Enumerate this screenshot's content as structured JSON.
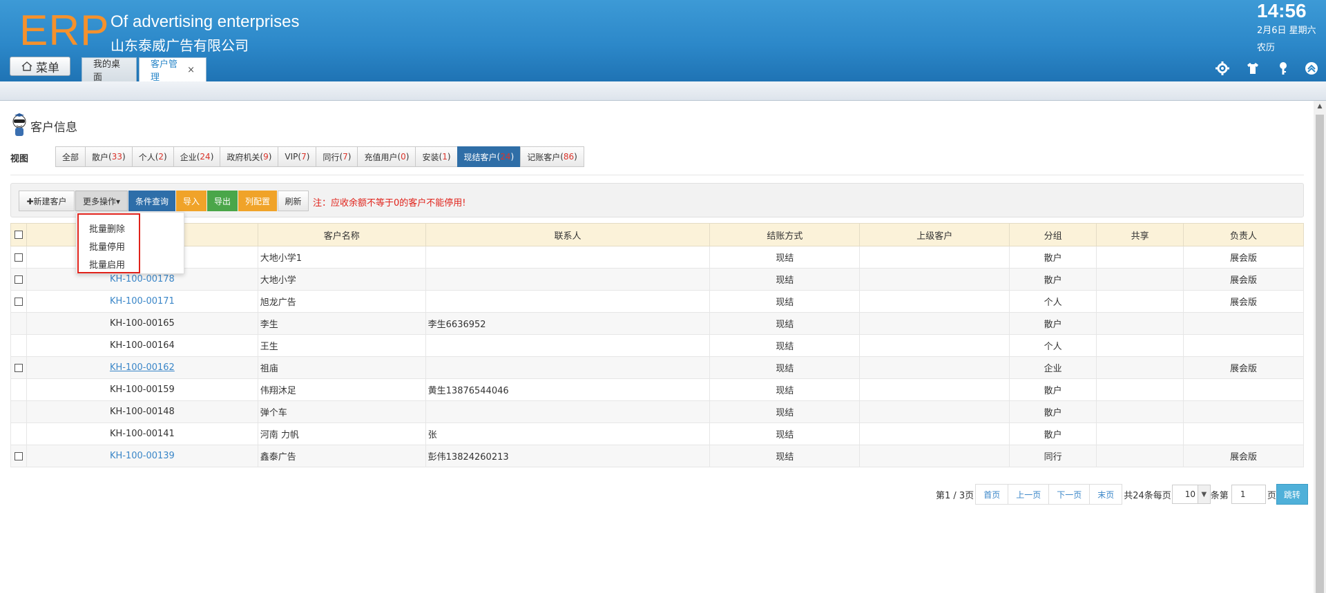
{
  "header": {
    "logo": "ERP",
    "company_en": "Of advertising enterprises",
    "company_cn": "山东泰威广告有限公司",
    "clock": "14:56",
    "date": "2月6日 星期六",
    "lunar": "农历",
    "menu_label": "菜单",
    "tabs": [
      {
        "label": "我的桌面"
      },
      {
        "label": "客户管理",
        "close": "×"
      }
    ],
    "tools": [
      "gear-icon",
      "shirt-icon",
      "key-icon",
      "chevron-up-circle-icon"
    ]
  },
  "page": {
    "title": "客户信息",
    "view_label": "视图",
    "views": [
      {
        "name": "全部",
        "count": ""
      },
      {
        "name": "散户",
        "count": "33"
      },
      {
        "name": "个人",
        "count": "2"
      },
      {
        "name": "企业",
        "count": "24"
      },
      {
        "name": "政府机关",
        "count": "9"
      },
      {
        "name": "VIP",
        "count": "7"
      },
      {
        "name": "同行",
        "count": "7"
      },
      {
        "name": "充值用户",
        "count": "0"
      },
      {
        "name": "安装",
        "count": "1"
      },
      {
        "name": "现结客户",
        "count": "24"
      },
      {
        "name": "记账客户",
        "count": "86"
      }
    ]
  },
  "toolbar": {
    "new": "✚新建客户",
    "more": "更多操作▾",
    "query": "条件查询",
    "import": "导入",
    "export": "导出",
    "columns": "列配置",
    "refresh": "刷新",
    "notice": "注：应收余额不等于0的客户不能停用!"
  },
  "dropdown": {
    "items": [
      "批量删除",
      "批量停用",
      "批量启用"
    ]
  },
  "table": {
    "headers": [
      "",
      "",
      "客户名称",
      "联系人",
      "结账方式",
      "上级客户",
      "分组",
      "共享",
      "负责人"
    ],
    "rows": [
      {
        "checkbox": true,
        "code": "",
        "link": false,
        "name": "大地小学1",
        "contact": "",
        "pay": "现结",
        "parent": "",
        "group": "散户",
        "share": "",
        "owner": "展会版"
      },
      {
        "checkbox": true,
        "code": "KH-100-00178",
        "link": true,
        "name": "大地小学",
        "contact": "",
        "pay": "现结",
        "parent": "",
        "group": "散户",
        "share": "",
        "owner": "展会版"
      },
      {
        "checkbox": true,
        "code": "KH-100-00171",
        "link": true,
        "name": "旭龙广告",
        "contact": "",
        "pay": "现结",
        "parent": "",
        "group": "个人",
        "share": "",
        "owner": "展会版"
      },
      {
        "checkbox": false,
        "code": "KH-100-00165",
        "link": false,
        "name": "李生",
        "contact": "李生6636952",
        "pay": "现结",
        "parent": "",
        "group": "散户",
        "share": "",
        "owner": ""
      },
      {
        "checkbox": false,
        "code": "KH-100-00164",
        "link": false,
        "name": "王生",
        "contact": "",
        "pay": "现结",
        "parent": "",
        "group": "个人",
        "share": "",
        "owner": ""
      },
      {
        "checkbox": true,
        "code": "KH-100-00162",
        "link": true,
        "underline": true,
        "name": "祖庙",
        "contact": "",
        "pay": "现结",
        "parent": "",
        "group": "企业",
        "share": "",
        "owner": "展会版"
      },
      {
        "checkbox": false,
        "code": "KH-100-00159",
        "link": false,
        "name": "伟翔沐足",
        "contact": "黄生13876544046",
        "pay": "现结",
        "parent": "",
        "group": "散户",
        "share": "",
        "owner": ""
      },
      {
        "checkbox": false,
        "code": "KH-100-00148",
        "link": false,
        "name": "弹个车",
        "contact": "",
        "pay": "现结",
        "parent": "",
        "group": "散户",
        "share": "",
        "owner": ""
      },
      {
        "checkbox": false,
        "code": "KH-100-00141",
        "link": false,
        "name": "河南 力帆",
        "contact": "张",
        "pay": "现结",
        "parent": "",
        "group": "散户",
        "share": "",
        "owner": ""
      },
      {
        "checkbox": true,
        "code": "KH-100-00139",
        "link": true,
        "name": "鑫泰广告",
        "contact": "彭伟13824260213",
        "pay": "现结",
        "parent": "",
        "group": "同行",
        "share": "",
        "owner": "展会版"
      }
    ]
  },
  "pagination": {
    "page_info": "第1 / 3页",
    "first": "首页",
    "prev": "上一页",
    "next": "下一页",
    "last": "末页",
    "total": "共24条每页",
    "per_page": "10",
    "unit": "条第",
    "page_input": "1",
    "page_unit": "页",
    "jump": "跳转"
  },
  "colors": {
    "header_blue": "#2c88c9",
    "logo_orange": "#f5912c",
    "active_view": "#2f6ea7",
    "count_red": "#d9342b",
    "link_blue": "#3a86c8",
    "notice_red": "#e0221a",
    "table_header_bg": "#fbf2d9"
  }
}
